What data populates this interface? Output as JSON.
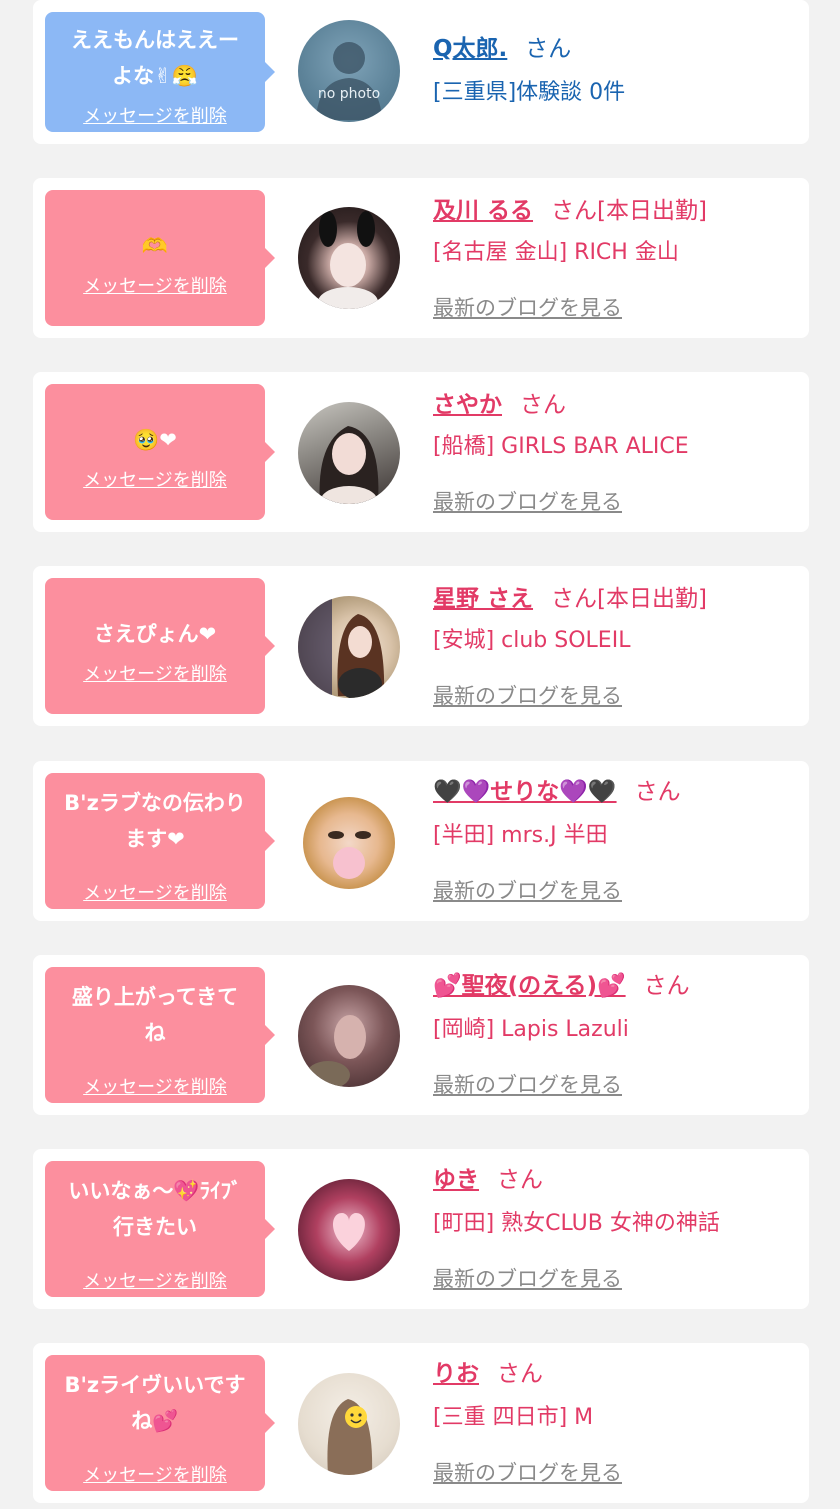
{
  "cards": [
    {
      "message": "ええもんはええー",
      "message2": "よな✌😤",
      "delete_label": "メッセージを削除",
      "name": "Q太郎.",
      "san": "さん",
      "shop": "[三重県]体験談 0件",
      "avatar_text": "no photo"
    },
    {
      "message": "🫶",
      "delete_label": "メッセージを削除",
      "name": "及川 るる",
      "san": "さん[本日出勤]",
      "shop": "[名古屋 金山] RICH 金山",
      "blog": "最新のブログを見る"
    },
    {
      "message": "🥹❤",
      "delete_label": "メッセージを削除",
      "name": "さやか",
      "san": "さん",
      "shop": "[船橋] GIRLS BAR ALICE",
      "blog": "最新のブログを見る"
    },
    {
      "message": "さえぴょん❤",
      "delete_label": "メッセージを削除",
      "name": "星野 さえ",
      "san": "さん[本日出勤]",
      "shop": "[安城] club SOLEIL",
      "blog": "最新のブログを見る"
    },
    {
      "message": "B'zラブなの伝わり",
      "message2": "ます❤",
      "delete_label": "メッセージを削除",
      "name": "🖤💜せりな💜🖤",
      "san": "さん",
      "shop": "[半田] mrs.J 半田",
      "blog": "最新のブログを見る"
    },
    {
      "message": "盛り上がってきて",
      "message2": "ね",
      "delete_label": "メッセージを削除",
      "name": "💕聖夜(のえる)💕",
      "san": "さん",
      "shop": "[岡崎] Lapis Lazuli",
      "blog": "最新のブログを見る"
    },
    {
      "message": "いいなぁ～💖ﾗｲﾌﾞ",
      "message2": "行きたい",
      "delete_label": "メッセージを削除",
      "name": "ゆき",
      "san": "さん",
      "shop": "[町田] 熟女CLUB 女神の神話",
      "blog": "最新のブログを見る"
    },
    {
      "message": "B'zライヴいいです",
      "message2": "ね💕",
      "delete_label": "メッセージを削除",
      "name": "りお",
      "san": "さん",
      "shop": "[三重 四日市] M",
      "blog": "最新のブログを見る"
    }
  ],
  "colors": {
    "pink_bubble": "#fc8f9e",
    "blue_bubble": "#8cb8f5",
    "pink_text": "#e23a66",
    "blue_text": "#1a64b0"
  }
}
